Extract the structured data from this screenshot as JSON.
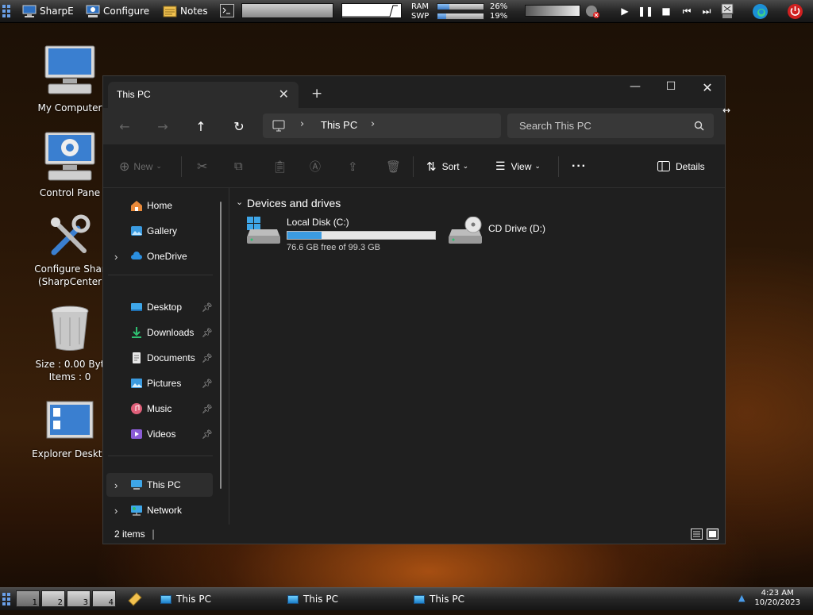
{
  "top_panel": {
    "apps": [
      {
        "label": "SharpE",
        "icon": "monitor-icon"
      },
      {
        "label": "Configure",
        "icon": "monitor-gear-icon"
      },
      {
        "label": "Notes",
        "icon": "notes-icon"
      }
    ],
    "meters": [
      {
        "label": "RAM",
        "percent_text": "26%",
        "value": 0.26
      },
      {
        "label": "SWP",
        "percent_text": "19%",
        "value": 0.19
      }
    ]
  },
  "desktop": {
    "icons": [
      {
        "label": "My Computer"
      },
      {
        "label": "Control Pane"
      },
      {
        "label": "Configure Shar"
      },
      {
        "label": "(SharpCenter"
      },
      {
        "label": "Size : 0.00 Byt"
      },
      {
        "label": "Items : 0"
      },
      {
        "label": "Explorer Deskto"
      }
    ]
  },
  "explorer": {
    "tab_title": "This PC",
    "address_crumb": "This PC",
    "search_placeholder": "Search This PC",
    "toolbar": {
      "new_label": "New",
      "sort_label": "Sort",
      "view_label": "View",
      "details_label": "Details"
    },
    "sidebar": {
      "items": [
        {
          "label": "Home"
        },
        {
          "label": "Gallery"
        },
        {
          "label": "OneDrive"
        },
        {
          "label": "Desktop"
        },
        {
          "label": "Downloads"
        },
        {
          "label": "Documents"
        },
        {
          "label": "Pictures"
        },
        {
          "label": "Music"
        },
        {
          "label": "Videos"
        },
        {
          "label": "This PC"
        },
        {
          "label": "Network"
        }
      ]
    },
    "section_title": "Devices and drives",
    "drives": [
      {
        "name": "Local Disk (C:)",
        "free_text": "76.6 GB free of 99.3 GB",
        "used_fraction": 0.23
      },
      {
        "name": "CD Drive (D:)"
      }
    ],
    "status_text": "2 items"
  },
  "taskbar": {
    "workspaces": [
      "1",
      "2",
      "3",
      "4"
    ],
    "tasks": [
      {
        "label": "This PC"
      },
      {
        "label": "This PC"
      },
      {
        "label": "This PC"
      }
    ],
    "clock_time": "4:23 AM",
    "clock_date": "10/20/2023"
  },
  "colors": {
    "accent": "#3b9be0",
    "window_bg": "#1f1f1f",
    "panel_bg": "#262626"
  }
}
